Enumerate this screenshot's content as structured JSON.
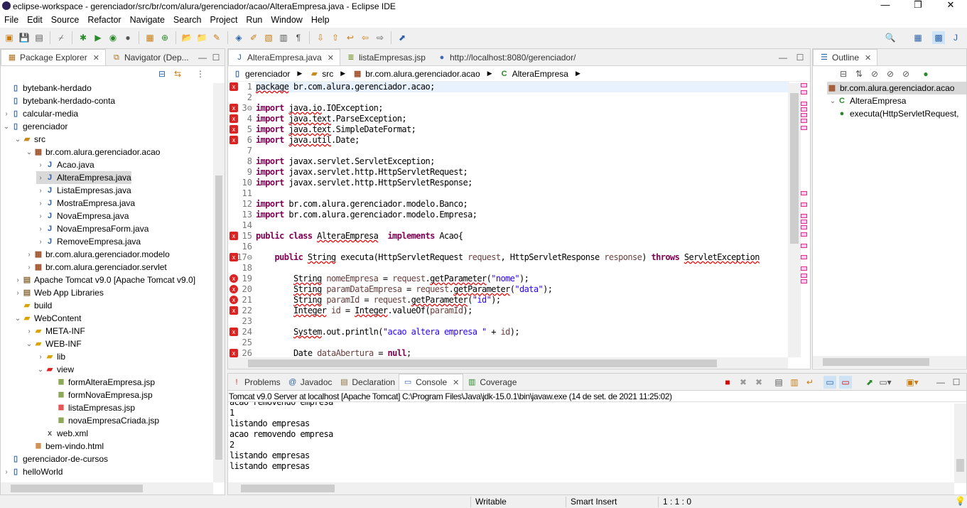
{
  "window": {
    "title": "eclipse-workspace - gerenciador/src/br/com/alura/gerenciador/acao/AlteraEmpresa.java - Eclipse IDE",
    "minimize": "—",
    "maximize": "❐",
    "close": "✕"
  },
  "menu": [
    "File",
    "Edit",
    "Source",
    "Refactor",
    "Navigate",
    "Search",
    "Project",
    "Run",
    "Window",
    "Help"
  ],
  "left_panel": {
    "tabs": [
      {
        "label": "Package Explorer",
        "active": true
      },
      {
        "label": "Navigator (Dep...",
        "active": false
      }
    ],
    "tree": [
      {
        "label": "bytebank-herdado",
        "level": 0,
        "arrow": "",
        "icon": "project-icon"
      },
      {
        "label": "bytebank-herdado-conta",
        "level": 0,
        "arrow": "",
        "icon": "project-icon"
      },
      {
        "label": "calcular-media",
        "level": 0,
        "arrow": "›",
        "icon": "project-icon"
      },
      {
        "label": "gerenciador",
        "level": 0,
        "arrow": "⌄",
        "icon": "project-icon"
      },
      {
        "label": "src",
        "level": 1,
        "arrow": "⌄",
        "icon": "source-folder-icon"
      },
      {
        "label": "br.com.alura.gerenciador.acao",
        "level": 2,
        "arrow": "⌄",
        "icon": "package-icon"
      },
      {
        "label": "Acao.java",
        "level": 3,
        "arrow": "›",
        "icon": "java-file-icon"
      },
      {
        "label": "AlteraEmpresa.java",
        "level": 3,
        "arrow": "›",
        "icon": "java-file-icon",
        "selected": true
      },
      {
        "label": "ListaEmpresas.java",
        "level": 3,
        "arrow": "›",
        "icon": "java-file-icon"
      },
      {
        "label": "MostraEmpresa.java",
        "level": 3,
        "arrow": "›",
        "icon": "java-file-icon"
      },
      {
        "label": "NovaEmpresa.java",
        "level": 3,
        "arrow": "›",
        "icon": "java-file-icon"
      },
      {
        "label": "NovaEmpresaForm.java",
        "level": 3,
        "arrow": "›",
        "icon": "java-file-icon"
      },
      {
        "label": "RemoveEmpresa.java",
        "level": 3,
        "arrow": "›",
        "icon": "java-file-icon"
      },
      {
        "label": "br.com.alura.gerenciador.modelo",
        "level": 2,
        "arrow": "›",
        "icon": "package-icon"
      },
      {
        "label": "br.com.alura.gerenciador.servlet",
        "level": 2,
        "arrow": "›",
        "icon": "package-icon"
      },
      {
        "label": "Apache Tomcat v9.0 [Apache Tomcat v9.0]",
        "level": 1,
        "arrow": "›",
        "icon": "library-icon"
      },
      {
        "label": "Web App Libraries",
        "level": 1,
        "arrow": "›",
        "icon": "library-icon"
      },
      {
        "label": "build",
        "level": 1,
        "arrow": "",
        "icon": "folder-icon"
      },
      {
        "label": "WebContent",
        "level": 1,
        "arrow": "⌄",
        "icon": "folder-icon"
      },
      {
        "label": "META-INF",
        "level": 2,
        "arrow": "›",
        "icon": "folder-icon"
      },
      {
        "label": "WEB-INF",
        "level": 2,
        "arrow": "⌄",
        "icon": "folder-icon"
      },
      {
        "label": "lib",
        "level": 3,
        "arrow": "›",
        "icon": "folder-icon"
      },
      {
        "label": "view",
        "level": 3,
        "arrow": "⌄",
        "icon": "folder-error-icon"
      },
      {
        "label": "formAlteraEmpresa.jsp",
        "level": 4,
        "arrow": "",
        "icon": "jsp-file-icon"
      },
      {
        "label": "formNovaEmpresa.jsp",
        "level": 4,
        "arrow": "",
        "icon": "jsp-file-icon"
      },
      {
        "label": "listaEmpresas.jsp",
        "level": 4,
        "arrow": "",
        "icon": "jsp-error-icon"
      },
      {
        "label": "novaEmpresaCriada.jsp",
        "level": 4,
        "arrow": "",
        "icon": "jsp-file-icon"
      },
      {
        "label": "web.xml",
        "level": 3,
        "arrow": "",
        "icon": "xml-file-icon"
      },
      {
        "label": "bem-vindo.html",
        "level": 2,
        "arrow": "",
        "icon": "html-file-icon"
      },
      {
        "label": "gerenciador-de-cursos",
        "level": 0,
        "arrow": "",
        "icon": "project-icon"
      },
      {
        "label": "helloWorld",
        "level": 0,
        "arrow": "›",
        "icon": "project-icon"
      }
    ]
  },
  "editor": {
    "tabs": [
      {
        "label": "AlteraEmpresa.java",
        "active": true
      },
      {
        "label": "listaEmpresas.jsp",
        "active": false
      },
      {
        "label": "http://localhost:8080/gerenciador/",
        "active": false
      }
    ],
    "breadcrumb": [
      "gerenciador",
      "src",
      "br.com.alura.gerenciador.acao",
      "AlteraEmpresa"
    ],
    "lines": [
      {
        "n": "1",
        "m": "w",
        "t": [
          [
            "package",
            "err"
          ],
          [
            " br.com.alura.gerenciador.acao;",
            ""
          ]
        ]
      },
      {
        "n": "2",
        "t": []
      },
      {
        "n": "3⊖",
        "m": "w",
        "t": [
          [
            "import",
            "kw"
          ],
          [
            " ",
            ""
          ],
          [
            "java.io",
            "err"
          ],
          [
            ".IOException;",
            ""
          ]
        ]
      },
      {
        "n": "4",
        "m": "w",
        "t": [
          [
            "import",
            "kw"
          ],
          [
            " ",
            ""
          ],
          [
            "java.text",
            "err"
          ],
          [
            ".ParseException;",
            ""
          ]
        ]
      },
      {
        "n": "5",
        "m": "w",
        "t": [
          [
            "import",
            "kw"
          ],
          [
            " ",
            ""
          ],
          [
            "java.text",
            "err"
          ],
          [
            ".SimpleDateFormat;",
            ""
          ]
        ]
      },
      {
        "n": "6",
        "m": "w",
        "t": [
          [
            "import",
            "kw"
          ],
          [
            " ",
            ""
          ],
          [
            "java.util",
            "err"
          ],
          [
            ".Date;",
            ""
          ]
        ]
      },
      {
        "n": "7",
        "t": []
      },
      {
        "n": "8",
        "t": [
          [
            "import",
            "kw"
          ],
          [
            " javax.servlet.ServletException;",
            ""
          ]
        ]
      },
      {
        "n": "9",
        "t": [
          [
            "import",
            "kw"
          ],
          [
            " javax.servlet.http.HttpServletRequest;",
            ""
          ]
        ]
      },
      {
        "n": "10",
        "t": [
          [
            "import",
            "kw"
          ],
          [
            " javax.servlet.http.HttpServletResponse;",
            ""
          ]
        ]
      },
      {
        "n": "11",
        "t": []
      },
      {
        "n": "12",
        "t": [
          [
            "import",
            "kw"
          ],
          [
            " br.com.alura.gerenciador.modelo.Banco;",
            ""
          ]
        ]
      },
      {
        "n": "13",
        "t": [
          [
            "import",
            "kw"
          ],
          [
            " br.com.alura.gerenciador.modelo.Empresa;",
            ""
          ]
        ]
      },
      {
        "n": "14",
        "t": []
      },
      {
        "n": "15",
        "m": "w",
        "t": [
          [
            "public class",
            "kw"
          ],
          [
            " ",
            ""
          ],
          [
            "AlteraEmpresa",
            "err"
          ],
          [
            "  ",
            ""
          ],
          [
            "implements",
            "kw"
          ],
          [
            " Acao{",
            ""
          ]
        ]
      },
      {
        "n": "16",
        "t": []
      },
      {
        "n": "17⊖",
        "m": "w",
        "t": [
          [
            "    ",
            ""
          ],
          [
            "public",
            "kw"
          ],
          [
            " ",
            ""
          ],
          [
            "String",
            "err"
          ],
          [
            " executa(HttpServletRequest ",
            ""
          ],
          [
            "request",
            "var"
          ],
          [
            ", HttpServletResponse ",
            ""
          ],
          [
            "response",
            "var"
          ],
          [
            ") ",
            ""
          ],
          [
            "throws",
            "kw"
          ],
          [
            " ",
            ""
          ],
          [
            "ServletException",
            "err"
          ]
        ]
      },
      {
        "n": "18",
        "t": []
      },
      {
        "n": "19",
        "m": "e",
        "t": [
          [
            "        ",
            ""
          ],
          [
            "String",
            "err"
          ],
          [
            " ",
            ""
          ],
          [
            "nomeEmpresa",
            "var"
          ],
          [
            " = ",
            ""
          ],
          [
            "request",
            "var"
          ],
          [
            ".",
            ""
          ],
          [
            "getParameter",
            "err"
          ],
          [
            "(",
            ""
          ],
          [
            "\"nome\"",
            "str"
          ],
          [
            ");",
            ""
          ]
        ]
      },
      {
        "n": "20",
        "m": "e",
        "t": [
          [
            "        ",
            ""
          ],
          [
            "String",
            "err"
          ],
          [
            " ",
            ""
          ],
          [
            "paramDataEmpresa",
            "var"
          ],
          [
            " = ",
            ""
          ],
          [
            "request",
            "var"
          ],
          [
            ".",
            ""
          ],
          [
            "getParameter",
            "err"
          ],
          [
            "(",
            ""
          ],
          [
            "\"data\"",
            "str"
          ],
          [
            ");",
            ""
          ]
        ]
      },
      {
        "n": "21",
        "m": "e",
        "t": [
          [
            "        ",
            ""
          ],
          [
            "String",
            "err"
          ],
          [
            " ",
            ""
          ],
          [
            "paramId",
            "var"
          ],
          [
            " = ",
            ""
          ],
          [
            "request",
            "var"
          ],
          [
            ".",
            ""
          ],
          [
            "getParameter",
            "err"
          ],
          [
            "(",
            ""
          ],
          [
            "\"id\"",
            "str"
          ],
          [
            ");",
            ""
          ]
        ]
      },
      {
        "n": "22",
        "m": "w",
        "t": [
          [
            "        ",
            ""
          ],
          [
            "Integer",
            "err"
          ],
          [
            " ",
            ""
          ],
          [
            "id",
            "var"
          ],
          [
            " = ",
            ""
          ],
          [
            "Integer",
            "err"
          ],
          [
            ".valueOf(",
            ""
          ],
          [
            "paramId",
            "var"
          ],
          [
            ");",
            ""
          ]
        ]
      },
      {
        "n": "23",
        "t": []
      },
      {
        "n": "24",
        "m": "w",
        "t": [
          [
            "        ",
            ""
          ],
          [
            "System",
            "err"
          ],
          [
            ".out.println(",
            ""
          ],
          [
            "\"acao altera empresa \"",
            "str"
          ],
          [
            " + ",
            ""
          ],
          [
            "id",
            "var"
          ],
          [
            ");",
            ""
          ]
        ]
      },
      {
        "n": "25",
        "t": []
      },
      {
        "n": "26",
        "m": "w",
        "t": [
          [
            "        Date ",
            ""
          ],
          [
            "dataAbertura",
            "var"
          ],
          [
            " = ",
            ""
          ],
          [
            "null",
            "kw"
          ],
          [
            ";",
            ""
          ]
        ]
      }
    ]
  },
  "outline": {
    "tab": "Outline",
    "items": [
      {
        "label": "br.com.alura.gerenciador.acao",
        "level": 0,
        "selected": true
      },
      {
        "label": "AlteraEmpresa",
        "level": 1
      },
      {
        "label": "executa(HttpServletRequest,",
        "level": 2
      }
    ]
  },
  "console": {
    "tabs": [
      {
        "label": "Problems"
      },
      {
        "label": "Javadoc"
      },
      {
        "label": "Declaration"
      },
      {
        "label": "Console",
        "active": true
      },
      {
        "label": "Coverage"
      }
    ],
    "header": "Tomcat v9.0 Server at localhost [Apache Tomcat] C:\\Program Files\\Java\\jdk-15.0.1\\bin\\javaw.exe  (14 de set. de 2021 11:25:02)",
    "lines": [
      "acao removendo empresa",
      "1",
      "listando empresas",
      "acao removendo empresa",
      "2",
      "listando empresas",
      "listando empresas"
    ]
  },
  "status": {
    "writable": "Writable",
    "insert_mode": "Smart Insert",
    "position": "1 : 1 : 0"
  }
}
